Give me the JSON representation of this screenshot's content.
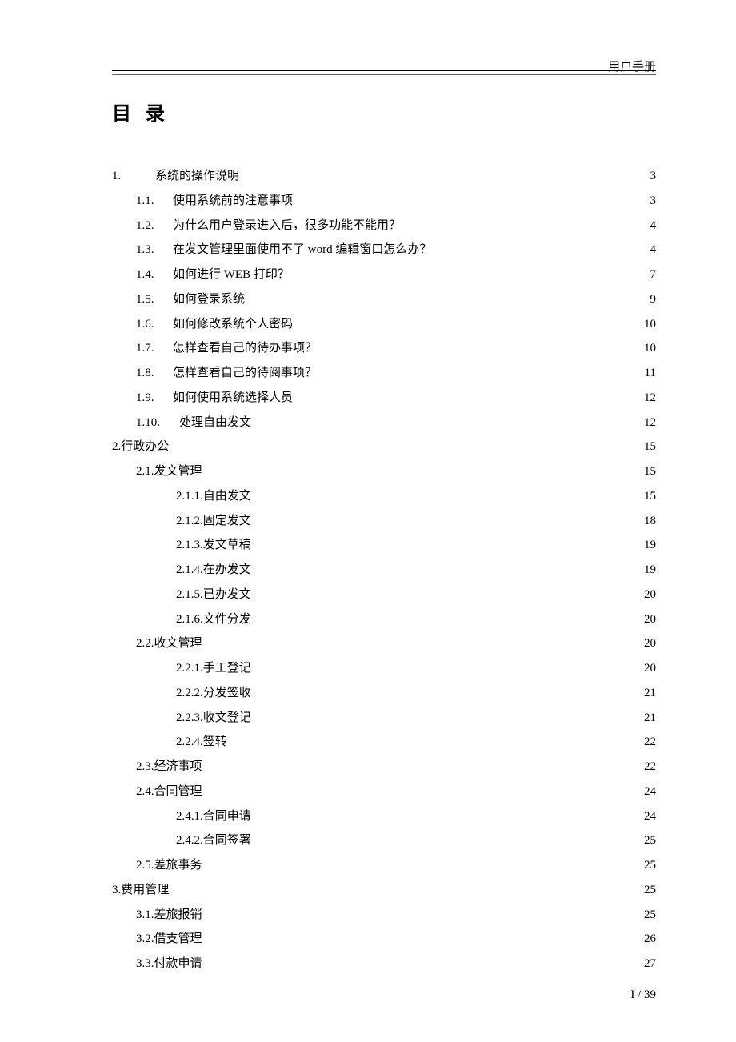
{
  "header": {
    "title": "用户手册"
  },
  "toc_title": "目 录",
  "footer": {
    "page": "I / 39"
  },
  "toc": [
    {
      "indent": 0,
      "num": "1.",
      "numWide": true,
      "text": "系统的操作说明",
      "gap": false,
      "page": "3"
    },
    {
      "indent": 1,
      "num": "1.1.",
      "numWide": false,
      "text": "使用系统前的注意事项",
      "gap": false,
      "page": "3"
    },
    {
      "indent": 1,
      "num": "1.2.",
      "numWide": false,
      "text": "为什么用户登录进入后，很多功能不能用？",
      "gap": false,
      "page": "4"
    },
    {
      "indent": 1,
      "num": "1.3.",
      "numWide": false,
      "text": "在发文管理里面使用不了 word 编辑窗口怎么办？",
      "gap": false,
      "page": "4"
    },
    {
      "indent": 1,
      "num": "1.4.",
      "numWide": false,
      "text": "如何进行 WEB 打印？",
      "gap": false,
      "page": "7"
    },
    {
      "indent": 1,
      "num": "1.5.",
      "numWide": false,
      "text": "如何登录系统",
      "gap": false,
      "page": "9"
    },
    {
      "indent": 1,
      "num": "1.6.",
      "numWide": false,
      "text": "如何修改系统个人密码",
      "gap": false,
      "page": "10"
    },
    {
      "indent": 1,
      "num": "1.7.",
      "numWide": false,
      "text": "怎样查看自己的待办事项？",
      "gap": false,
      "page": "10"
    },
    {
      "indent": 1,
      "num": "1.8.",
      "numWide": false,
      "text": "怎样查看自己的待阅事项？",
      "gap": false,
      "page": "11"
    },
    {
      "indent": 1,
      "num": "1.9.",
      "numWide": false,
      "text": "如何使用系统选择人员",
      "gap": false,
      "page": "12"
    },
    {
      "indent": 1,
      "num": "1.10.",
      "numWide": true,
      "text": "处理自由发文",
      "gap": false,
      "page": "12"
    },
    {
      "indent": 0,
      "num": "",
      "numWide": false,
      "text": "2.行政办公",
      "gap": false,
      "page": "15"
    },
    {
      "indent": 1,
      "num": "",
      "numWide": false,
      "text": "2.1.发文管理",
      "gap": true,
      "page": "15"
    },
    {
      "indent": 2,
      "num": "",
      "numWide": false,
      "text": "2.1.1.自由发文",
      "gap": false,
      "page": "15"
    },
    {
      "indent": 2,
      "num": "",
      "numWide": false,
      "text": "2.1.2.固定发文",
      "gap": false,
      "page": "18"
    },
    {
      "indent": 2,
      "num": "",
      "numWide": false,
      "text": "2.1.3.发文草稿",
      "gap": false,
      "page": "19"
    },
    {
      "indent": 2,
      "num": "",
      "numWide": false,
      "text": "2.1.4.在办发文",
      "gap": false,
      "page": "19"
    },
    {
      "indent": 2,
      "num": "",
      "numWide": false,
      "text": "2.1.5.已办发文",
      "gap": false,
      "page": "20"
    },
    {
      "indent": 2,
      "num": "",
      "numWide": false,
      "text": "2.1.6.文件分发",
      "gap": false,
      "page": "20"
    },
    {
      "indent": 1,
      "num": "",
      "numWide": false,
      "text": "2.2.收文管理",
      "gap": true,
      "page": "20"
    },
    {
      "indent": 2,
      "num": "",
      "numWide": false,
      "text": "2.2.1.手工登记",
      "gap": false,
      "page": "20"
    },
    {
      "indent": 2,
      "num": "",
      "numWide": false,
      "text": "2.2.2.分发签收",
      "gap": false,
      "page": "21"
    },
    {
      "indent": 2,
      "num": "",
      "numWide": false,
      "text": "2.2.3.收文登记",
      "gap": false,
      "page": "21"
    },
    {
      "indent": 2,
      "num": "",
      "numWide": false,
      "text": "2.2.4.签转",
      "gap": false,
      "page": "22"
    },
    {
      "indent": 1,
      "num": "",
      "numWide": false,
      "text": "2.3.经济事项",
      "gap": true,
      "page": "22"
    },
    {
      "indent": 1,
      "num": "",
      "numWide": false,
      "text": "2.4.合同管理",
      "gap": true,
      "page": "24"
    },
    {
      "indent": 2,
      "num": "",
      "numWide": false,
      "text": "2.4.1.合同申请",
      "gap": false,
      "page": "24"
    },
    {
      "indent": 2,
      "num": "",
      "numWide": false,
      "text": "2.4.2.合同签署",
      "gap": false,
      "page": "25"
    },
    {
      "indent": 1,
      "num": "",
      "numWide": false,
      "text": "2.5.差旅事务",
      "gap": true,
      "page": "25"
    },
    {
      "indent": 0,
      "num": "",
      "numWide": false,
      "text": "3.费用管理",
      "gap": false,
      "page": "25"
    },
    {
      "indent": 1,
      "num": "",
      "numWide": false,
      "text": "3.1.差旅报销",
      "gap": true,
      "page": "25"
    },
    {
      "indent": 1,
      "num": "",
      "numWide": false,
      "text": "3.2.借支管理",
      "gap": true,
      "page": "26"
    },
    {
      "indent": 1,
      "num": "",
      "numWide": false,
      "text": "3.3.付款申请",
      "gap": true,
      "page": "27"
    }
  ]
}
